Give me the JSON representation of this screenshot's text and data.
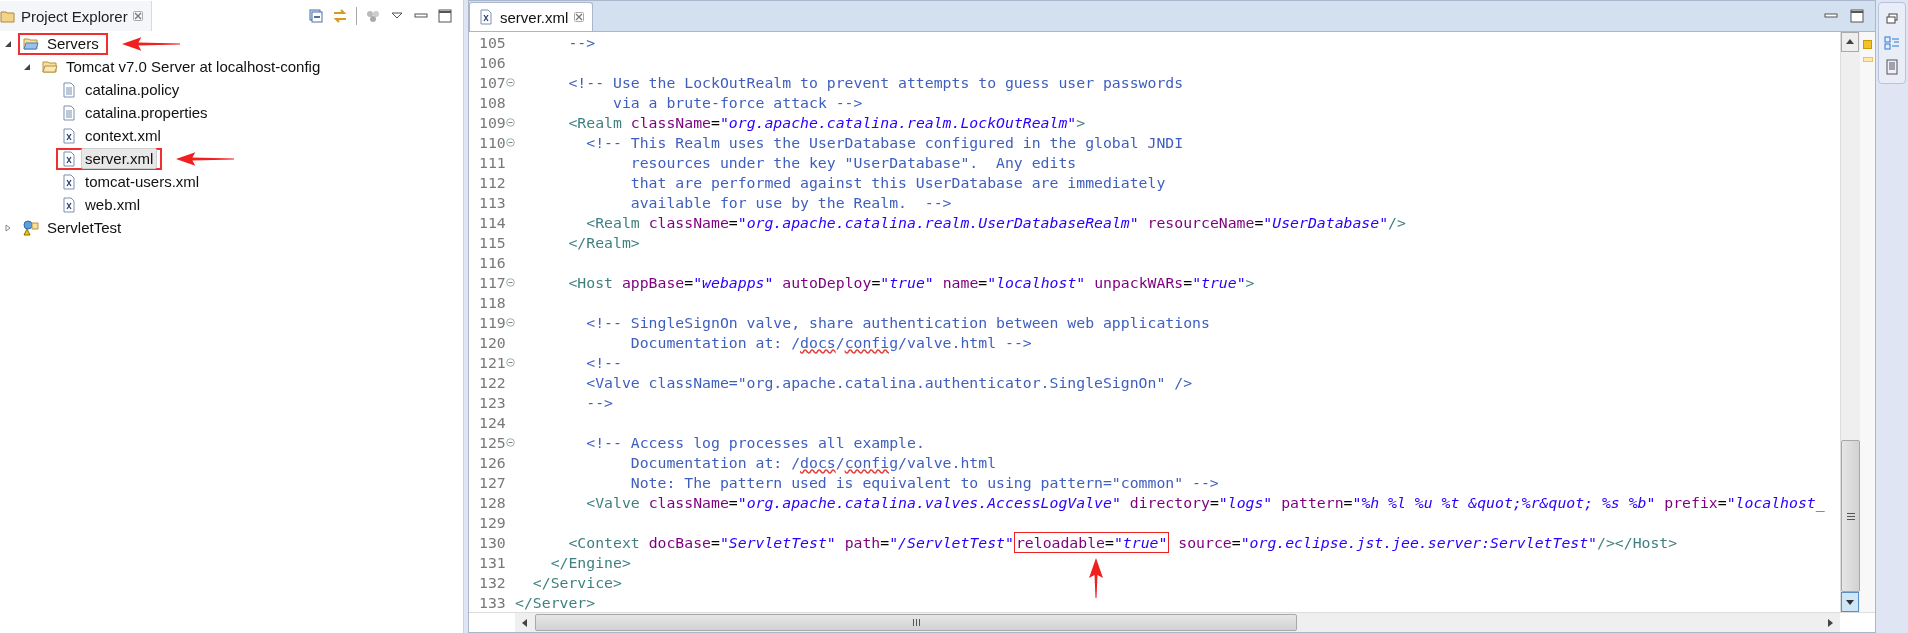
{
  "explorer": {
    "title": "Project Explorer",
    "tree": [
      {
        "label": "Servers",
        "kind": "folder",
        "expanded": true,
        "selected": false,
        "annotated": true,
        "children": [
          {
            "label": "Tomcat v7.0 Server at localhost-config",
            "kind": "folder",
            "expanded": true,
            "selected": false,
            "annotated": false,
            "children": [
              {
                "label": "catalina.policy",
                "kind": "text-file",
                "selected": false,
                "annotated": false
              },
              {
                "label": "catalina.properties",
                "kind": "text-file",
                "selected": false,
                "annotated": false
              },
              {
                "label": "context.xml",
                "kind": "xml-file",
                "selected": false,
                "annotated": false
              },
              {
                "label": "server.xml",
                "kind": "xml-file",
                "selected": true,
                "annotated": true
              },
              {
                "label": "tomcat-users.xml",
                "kind": "xml-file",
                "selected": false,
                "annotated": false
              },
              {
                "label": "web.xml",
                "kind": "xml-file",
                "selected": false,
                "annotated": false
              }
            ]
          }
        ]
      },
      {
        "label": "ServletTest",
        "kind": "project",
        "expanded": false,
        "selected": false,
        "annotated": false
      }
    ]
  },
  "editor": {
    "tab": {
      "title": "server.xml"
    },
    "lines": [
      {
        "num": "105",
        "fold": false,
        "tokens": [
          {
            "kind": "comment",
            "text": "-->"
          }
        ]
      },
      {
        "num": "106",
        "fold": false
      },
      {
        "num": "107",
        "fold": true,
        "tokens": [
          {
            "kind": "comment",
            "text": "<!-- Use the LockOutRealm to prevent attempts to guess user passwords"
          }
        ]
      },
      {
        "num": "108",
        "fold": false,
        "tokens": [
          {
            "kind": "comment",
            "text": "via a brute-force attack -->"
          }
        ]
      },
      {
        "num": "109",
        "fold": true,
        "tokens": [
          {
            "kind": "tag",
            "text": "<Realm"
          },
          {
            "kind": "attr",
            "text": " className"
          },
          {
            "kind": "eq",
            "text": "="
          },
          {
            "kind": "value",
            "text": "\"org.apache.catalina.realm.LockOutRealm\""
          },
          {
            "kind": "tag",
            "text": ">"
          }
        ]
      },
      {
        "num": "110",
        "fold": true,
        "tokens": [
          {
            "kind": "comment",
            "text": "<!-- This Realm uses the UserDatabase configured in the global JNDI"
          }
        ]
      },
      {
        "num": "111",
        "fold": false,
        "tokens": [
          {
            "kind": "comment",
            "text": "resources under the key \"UserDatabase\".  Any edits"
          }
        ]
      },
      {
        "num": "112",
        "fold": false,
        "tokens": [
          {
            "kind": "comment",
            "text": "that are performed against this UserDatabase are immediately"
          }
        ]
      },
      {
        "num": "113",
        "fold": false,
        "tokens": [
          {
            "kind": "comment",
            "text": "available for use by the Realm.  -->"
          }
        ]
      },
      {
        "num": "114",
        "fold": false,
        "tokens": [
          {
            "kind": "tag",
            "text": "<Realm"
          },
          {
            "kind": "attr",
            "text": " className"
          },
          {
            "kind": "eq",
            "text": "="
          },
          {
            "kind": "value",
            "text": "\"org.apache.catalina.realm.UserDatabaseRealm\""
          },
          {
            "kind": "attr",
            "text": " resourceName"
          },
          {
            "kind": "eq",
            "text": "="
          },
          {
            "kind": "value",
            "text": "\"UserDatabase\""
          },
          {
            "kind": "tag",
            "text": "/>"
          }
        ]
      },
      {
        "num": "115",
        "fold": false,
        "tokens": [
          {
            "kind": "tag",
            "text": "</Realm>"
          }
        ]
      },
      {
        "num": "116",
        "fold": false
      },
      {
        "num": "117",
        "fold": true,
        "tokens": [
          {
            "kind": "tag",
            "text": "<Host"
          },
          {
            "kind": "attr",
            "text": " appBase"
          },
          {
            "kind": "eq",
            "text": "="
          },
          {
            "kind": "value",
            "text": "\"webapps\""
          },
          {
            "kind": "attr",
            "text": " autoDeploy"
          },
          {
            "kind": "eq",
            "text": "="
          },
          {
            "kind": "value",
            "text": "\"true\""
          },
          {
            "kind": "attr",
            "text": " name"
          },
          {
            "kind": "eq",
            "text": "="
          },
          {
            "kind": "value",
            "text": "\"localhost\""
          },
          {
            "kind": "attr",
            "text": " unpackWARs"
          },
          {
            "kind": "eq",
            "text": "="
          },
          {
            "kind": "value",
            "text": "\"true\""
          },
          {
            "kind": "tag",
            "text": ">"
          }
        ]
      },
      {
        "num": "118",
        "fold": false
      },
      {
        "num": "119",
        "fold": true,
        "tokens": [
          {
            "kind": "comment",
            "text": "<!-- SingleSignOn valve, share authentication between web applications"
          }
        ]
      },
      {
        "num": "120",
        "fold": false,
        "tokens": [
          {
            "kind": "comment",
            "text": "Documentation at: /"
          },
          {
            "kind": "typo",
            "text": "docs"
          },
          {
            "kind": "comment",
            "text": "/"
          },
          {
            "kind": "typo",
            "text": "config"
          },
          {
            "kind": "comment",
            "text": "/valve.html -->"
          }
        ]
      },
      {
        "num": "121",
        "fold": true,
        "tokens": [
          {
            "kind": "comment",
            "text": "<!--"
          }
        ]
      },
      {
        "num": "122",
        "fold": false,
        "tokens": [
          {
            "kind": "comment",
            "text": "<Valve className=\"org.apache.catalina.authenticator.SingleSignOn\" />"
          }
        ]
      },
      {
        "num": "123",
        "fold": false,
        "tokens": [
          {
            "kind": "comment",
            "text": "-->"
          }
        ]
      },
      {
        "num": "124",
        "fold": false
      },
      {
        "num": "125",
        "fold": true,
        "tokens": [
          {
            "kind": "comment",
            "text": "<!-- Access log processes all example."
          }
        ]
      },
      {
        "num": "126",
        "fold": false,
        "tokens": [
          {
            "kind": "comment",
            "text": "Documentation at: /"
          },
          {
            "kind": "typo",
            "text": "docs"
          },
          {
            "kind": "comment",
            "text": "/"
          },
          {
            "kind": "typo",
            "text": "config"
          },
          {
            "kind": "comment",
            "text": "/valve.html"
          }
        ]
      },
      {
        "num": "127",
        "fold": false,
        "tokens": [
          {
            "kind": "comment",
            "text": "Note: The pattern used is equivalent to using pattern=\"common\" -->"
          }
        ]
      },
      {
        "num": "128",
        "fold": false,
        "tokens": [
          {
            "kind": "tag",
            "text": "<Valve"
          },
          {
            "kind": "attr",
            "text": " className"
          },
          {
            "kind": "eq",
            "text": "="
          },
          {
            "kind": "value",
            "text": "\"org.apache.catalina.valves.AccessLogValve\""
          },
          {
            "kind": "attr",
            "text": " directory"
          },
          {
            "kind": "eq",
            "text": "="
          },
          {
            "kind": "value",
            "text": "\"logs\""
          },
          {
            "kind": "attr",
            "text": " pattern"
          },
          {
            "kind": "eq",
            "text": "="
          },
          {
            "kind": "value",
            "text": "\"%h %l %u %t &quot;%r&quot; %s %b\""
          },
          {
            "kind": "attr",
            "text": " prefix"
          },
          {
            "kind": "eq",
            "text": "="
          },
          {
            "kind": "value",
            "text": "\"localhost_"
          }
        ]
      },
      {
        "num": "129",
        "fold": false
      },
      {
        "num": "130",
        "fold": false,
        "tokens": [
          {
            "kind": "tag",
            "text": "<Context"
          },
          {
            "kind": "attr",
            "text": " docBase"
          },
          {
            "kind": "eq",
            "text": "="
          },
          {
            "kind": "value",
            "text": "\"ServletTest\""
          },
          {
            "kind": "attr",
            "text": " path"
          },
          {
            "kind": "eq",
            "text": "="
          },
          {
            "kind": "value",
            "text": "\"/ServletTest\""
          },
          {
            "kind": "group",
            "annotated": true,
            "tokens": [
              {
                "kind": "attr",
                "text": "reloadable"
              },
              {
                "kind": "eq",
                "text": "="
              },
              {
                "kind": "value",
                "text": "\"true\""
              }
            ]
          },
          {
            "kind": "attr",
            "text": " source"
          },
          {
            "kind": "eq",
            "text": "="
          },
          {
            "kind": "value",
            "text": "\"org.eclipse.jst.jee.server:ServletTest\""
          },
          {
            "kind": "tag",
            "text": "/></Host>"
          }
        ]
      },
      {
        "num": "131",
        "fold": false,
        "tokens": [
          {
            "kind": "tag",
            "text": "</Engine>"
          }
        ]
      },
      {
        "num": "132",
        "fold": false,
        "tokens": [
          {
            "kind": "tag",
            "text": "</Service>"
          }
        ]
      },
      {
        "num": "133",
        "fold": false,
        "tokens": [
          {
            "kind": "tag",
            "text": "</Server>"
          }
        ]
      }
    ]
  }
}
